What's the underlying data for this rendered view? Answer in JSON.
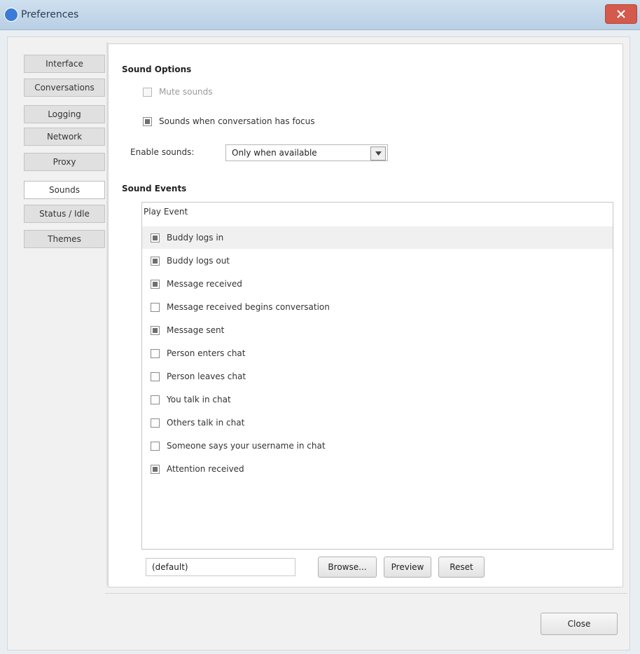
{
  "window": {
    "title": "Preferences",
    "accent": "#d35a4c"
  },
  "nav": {
    "tabs": [
      {
        "label": "Interface",
        "active": false
      },
      {
        "label": "Conversations",
        "active": false
      },
      {
        "label": "Logging",
        "active": false
      },
      {
        "label": "Network",
        "active": false
      },
      {
        "label": "Proxy",
        "active": false
      },
      {
        "label": "Sounds",
        "active": true
      },
      {
        "label": "Status / Idle",
        "active": false
      },
      {
        "label": "Themes",
        "active": false
      }
    ]
  },
  "sound_options": {
    "title": "Sound Options",
    "mute": {
      "label": "Mute sounds",
      "checked": false,
      "disabled": true
    },
    "focus": {
      "label": "Sounds when conversation has focus",
      "checked": true
    },
    "enable_label": "Enable sounds:",
    "enable_value": "Only when available"
  },
  "sound_events": {
    "title": "Sound Events",
    "column_header": "Play   Event",
    "items": [
      {
        "label": "Buddy logs in",
        "checked": true,
        "selected": true
      },
      {
        "label": "Buddy logs out",
        "checked": true,
        "selected": false
      },
      {
        "label": "Message received",
        "checked": true,
        "selected": false
      },
      {
        "label": "Message received begins conversation",
        "checked": false,
        "selected": false
      },
      {
        "label": "Message sent",
        "checked": true,
        "selected": false
      },
      {
        "label": "Person enters chat",
        "checked": false,
        "selected": false
      },
      {
        "label": "Person leaves chat",
        "checked": false,
        "selected": false
      },
      {
        "label": "You talk in chat",
        "checked": false,
        "selected": false
      },
      {
        "label": "Others talk in chat",
        "checked": false,
        "selected": false
      },
      {
        "label": "Someone says your username in chat",
        "checked": false,
        "selected": false
      },
      {
        "label": "Attention received",
        "checked": true,
        "selected": false
      }
    ]
  },
  "bottom": {
    "file_value": "(default)",
    "browse_label": "Browse...",
    "preview_label": "Preview",
    "reset_label": "Reset"
  },
  "footer": {
    "close_label": "Close"
  }
}
